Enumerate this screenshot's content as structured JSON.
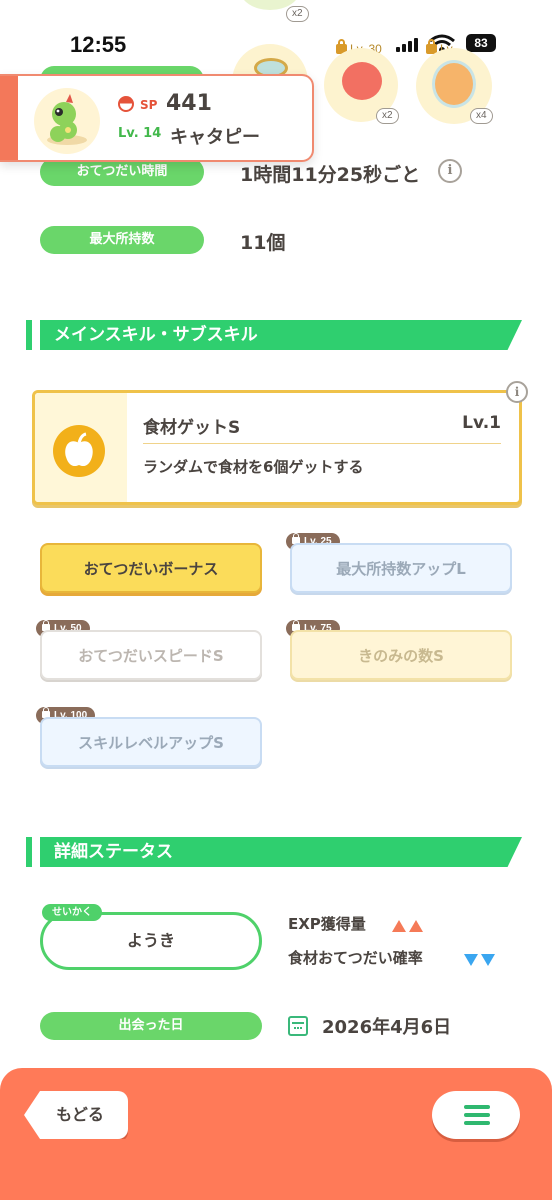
{
  "status_bar": {
    "time": "12:55",
    "battery": "83"
  },
  "top_ingredients": [
    {
      "badge": "x2"
    },
    {
      "lock_level": "Lv. 30",
      "badge": "x2"
    },
    {
      "lock_level": "Lv.",
      "badge": "x4"
    }
  ],
  "pokemon": {
    "sp_label": "SP",
    "sp_value": "441",
    "level": "Lv. 14",
    "name": "キャタピー"
  },
  "stats": [
    {
      "label": "おてつだい時間",
      "value": "1時間11分25秒ごと"
    },
    {
      "label": "最大所持数",
      "value": "11個"
    }
  ],
  "sections": {
    "skills": "メインスキル・サブスキル",
    "details": "詳細ステータス"
  },
  "main_skill": {
    "name": "食材ゲットS",
    "level": "Lv.1",
    "description": "ランダムで食材を6個ゲットする",
    "info": "i"
  },
  "sub_skills": [
    {
      "label": "おてつだいボーナス",
      "lock": ""
    },
    {
      "label": "最大所持数アップL",
      "lock": "Lv. 25"
    },
    {
      "label": "おてつだいスピードS",
      "lock": "Lv. 50"
    },
    {
      "label": "きのみの数S",
      "lock": "Lv. 75"
    },
    {
      "label": "スキルレベルアップS",
      "lock": "Lv. 100"
    }
  ],
  "nature": {
    "tag": "せいかく",
    "value": "ようき"
  },
  "nature_effects": [
    {
      "label": "EXP獲得量",
      "direction": "up"
    },
    {
      "label": "食材おてつだい確率",
      "direction": "down"
    }
  ],
  "met": {
    "label": "出会った日",
    "date": "2026年4月6日"
  },
  "footer": {
    "back_label": "もどる"
  },
  "colors": {
    "accent_green": "#2fcf6f",
    "footer_orange": "#ff7a58",
    "card_stripe": "#f3785a",
    "up": "#f57a57",
    "down": "#3aa6f0"
  }
}
